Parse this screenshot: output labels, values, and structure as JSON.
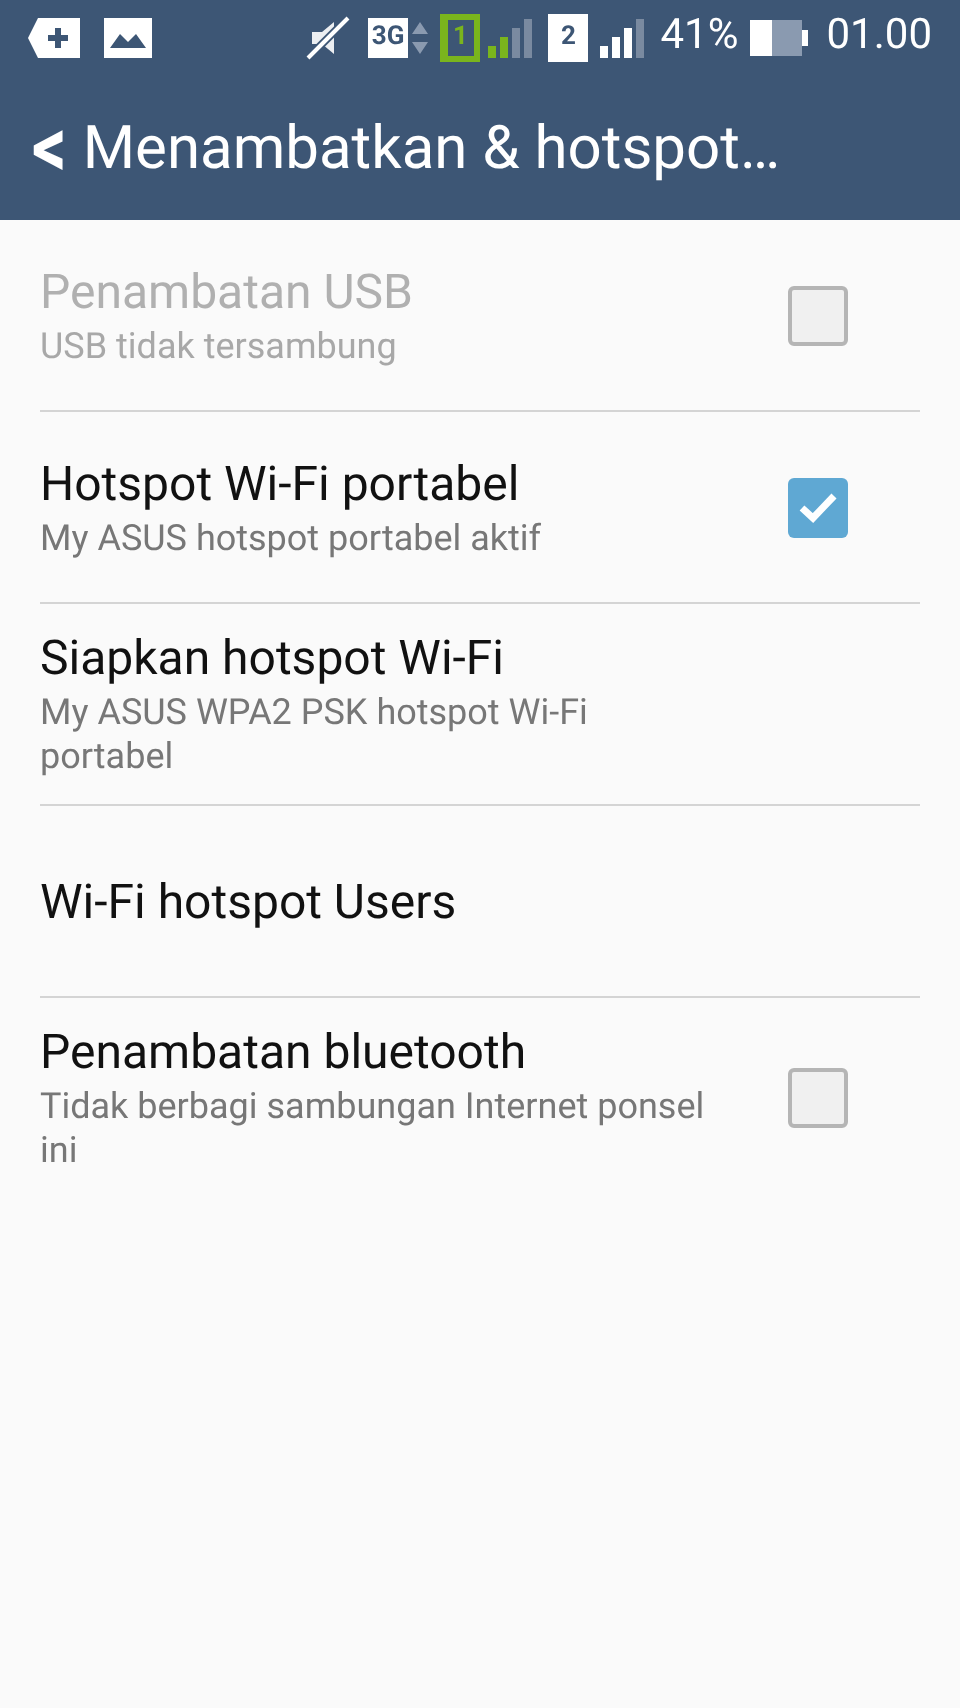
{
  "status_bar": {
    "network": "3G",
    "sim_1": "1",
    "sim_2": "2",
    "battery": "41%",
    "time": "01.00"
  },
  "header": {
    "back": "<",
    "title": "Menambatkan & hotspot…"
  },
  "items": [
    {
      "kind": "checkbox",
      "title": "Penambatan USB",
      "subtitle": "USB tidak tersambung",
      "disabled": true,
      "checked": false
    },
    {
      "kind": "checkbox",
      "title": "Hotspot Wi-Fi portabel",
      "subtitle": "My ASUS hotspot portabel aktif",
      "disabled": false,
      "checked": true
    },
    {
      "kind": "plain",
      "title": "Siapkan hotspot Wi-Fi",
      "subtitle": "My ASUS WPA2 PSK hotspot Wi-Fi portabel",
      "disabled": false
    },
    {
      "kind": "plain",
      "title": "Wi-Fi hotspot Users",
      "disabled": false
    },
    {
      "kind": "checkbox",
      "title": "Penambatan bluetooth",
      "subtitle": "Tidak berbagi sambungan Internet ponsel ini",
      "disabled": false,
      "checked": false
    }
  ]
}
